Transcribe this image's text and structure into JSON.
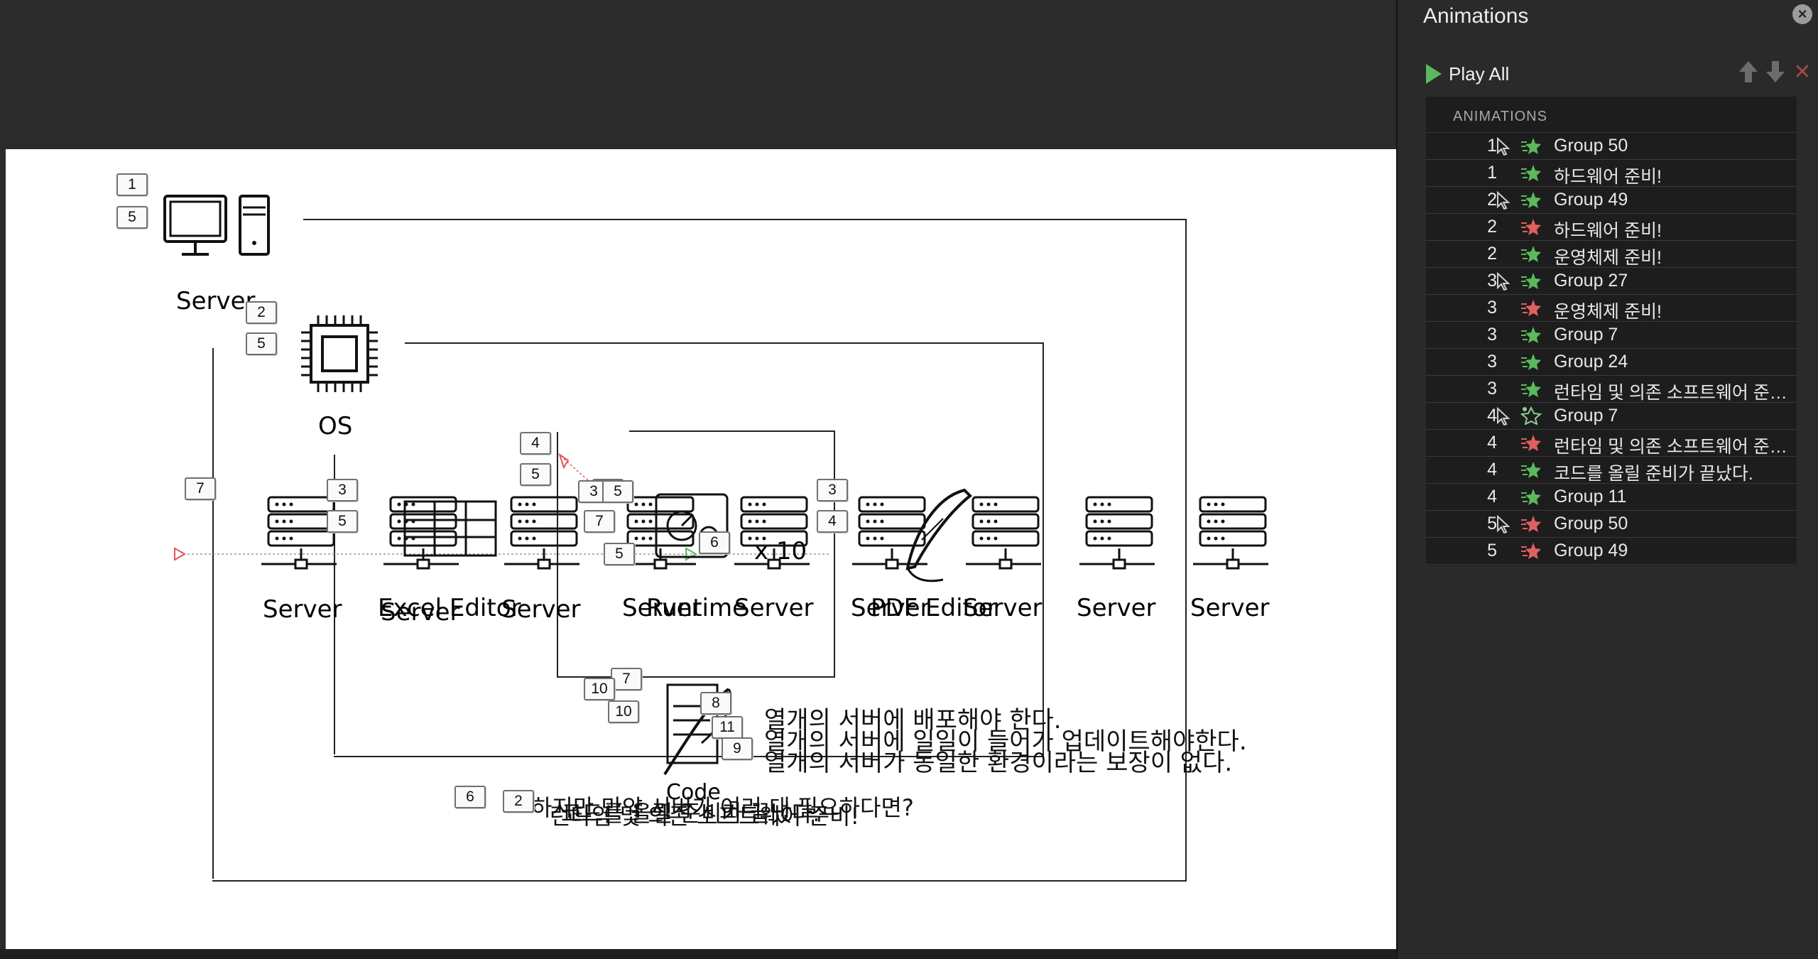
{
  "pane": {
    "title": "Animations",
    "play_all": "Play All",
    "list_header": "ANIMATIONS",
    "rows": [
      {
        "num": "1",
        "trigger": true,
        "effect": "entrance",
        "name": "Group 50"
      },
      {
        "num": "1",
        "trigger": false,
        "effect": "entrance",
        "name": "하드웨어 준비!"
      },
      {
        "num": "2",
        "trigger": true,
        "effect": "entrance",
        "name": "Group 49"
      },
      {
        "num": "2",
        "trigger": false,
        "effect": "exit",
        "name": "하드웨어 준비!"
      },
      {
        "num": "2",
        "trigger": false,
        "effect": "entrance",
        "name": "운영체제 준비!"
      },
      {
        "num": "3",
        "trigger": true,
        "effect": "entrance",
        "name": "Group 27"
      },
      {
        "num": "3",
        "trigger": false,
        "effect": "exit",
        "name": "운영체제 준비!"
      },
      {
        "num": "3",
        "trigger": false,
        "effect": "entrance",
        "name": "Group 7"
      },
      {
        "num": "3",
        "trigger": false,
        "effect": "entrance",
        "name": "Group 24"
      },
      {
        "num": "3",
        "trigger": false,
        "effect": "entrance",
        "name": "런타임 및 의존 소프트웨어 준…"
      },
      {
        "num": "4",
        "trigger": true,
        "effect": "motion",
        "name": "Group 7"
      },
      {
        "num": "4",
        "trigger": false,
        "effect": "exit",
        "name": "런타임 및 의존 소프트웨어 준…"
      },
      {
        "num": "4",
        "trigger": false,
        "effect": "entrance",
        "name": "코드를 올릴 준비가 끝났다."
      },
      {
        "num": "4",
        "trigger": false,
        "effect": "entrance",
        "name": "Group 11"
      },
      {
        "num": "5",
        "trigger": true,
        "effect": "exit",
        "name": "Group 50"
      },
      {
        "num": "5",
        "trigger": false,
        "effect": "exit",
        "name": "Group 49"
      }
    ]
  },
  "slide": {
    "labels": {
      "server_top": "Server",
      "os": "OS",
      "server_a": "Server",
      "excel": "Excel Editor",
      "server_b": "Server",
      "server_b2": "Server",
      "server_c": "Server",
      "runtime": "Runtime",
      "server_d": "Server",
      "server_e": "Server",
      "pdf": "PDF Editor",
      "server_f": "Server",
      "server_g": "Server",
      "server_h": "Server",
      "x10": "x 10",
      "code": "Code"
    },
    "korean_lines": [
      "열개의 서버에 배포해야 한다.",
      "열개의 서버에 일일이 들어가 업데이트해야한다.",
      "열개의 서버가 동일한 환경이라는 보장이 없다."
    ],
    "overlap_texts": [
      "하지만 만약 서버가 여러 대 필요하다면?",
      "코드를 올릴 준비가 끝났다.",
      "런타임 및 의존 소프트웨어 준비!"
    ],
    "tags": [
      "1",
      "5",
      "2",
      "5",
      "7",
      "3",
      "5",
      "4",
      "5",
      "5",
      "3",
      "4",
      "7",
      "5",
      "6",
      "3",
      "5",
      "7",
      "10",
      "10",
      "8",
      "11",
      "9",
      "6",
      "2"
    ]
  },
  "colors": {
    "entrance": "#5cb85c",
    "exit": "#e06060",
    "motion": "#8fcf8f",
    "accent_red": "#e05555"
  }
}
